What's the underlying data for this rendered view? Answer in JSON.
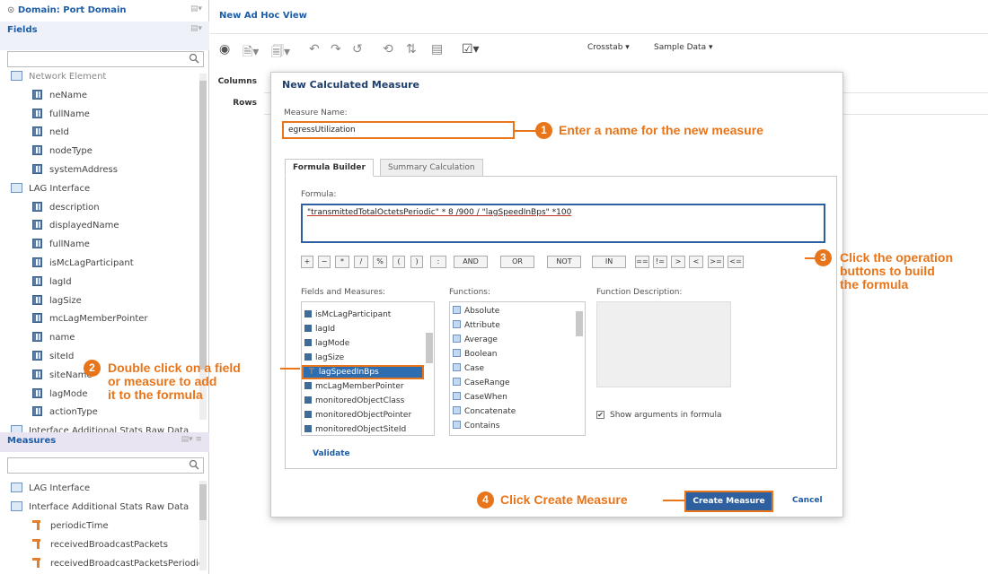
{
  "domain_panel": {
    "domain_label": "Domain: Port Domain",
    "fields_header": "Fields",
    "fields_items": [
      {
        "label": "Network Element",
        "kind": "group"
      },
      {
        "label": "neName",
        "kind": "field"
      },
      {
        "label": "fullName",
        "kind": "field"
      },
      {
        "label": "neId",
        "kind": "field"
      },
      {
        "label": "nodeType",
        "kind": "field"
      },
      {
        "label": "systemAddress",
        "kind": "field"
      },
      {
        "label": "LAG Interface",
        "kind": "group"
      },
      {
        "label": "description",
        "kind": "field"
      },
      {
        "label": "displayedName",
        "kind": "field"
      },
      {
        "label": "fullName",
        "kind": "field"
      },
      {
        "label": "isMcLagParticipant",
        "kind": "field"
      },
      {
        "label": "lagId",
        "kind": "field"
      },
      {
        "label": "lagSize",
        "kind": "field"
      },
      {
        "label": "mcLagMemberPointer",
        "kind": "field"
      },
      {
        "label": "name",
        "kind": "field"
      },
      {
        "label": "siteId",
        "kind": "field"
      },
      {
        "label": "siteName",
        "kind": "field"
      },
      {
        "label": "lagMode",
        "kind": "field"
      },
      {
        "label": "actionType",
        "kind": "field"
      },
      {
        "label": "Interface Additional Stats Raw Data",
        "kind": "group"
      }
    ],
    "measures_header": "Measures",
    "measures_items": [
      {
        "label": "LAG Interface",
        "kind": "group"
      },
      {
        "label": "Interface Additional Stats Raw Data",
        "kind": "group"
      },
      {
        "label": "periodicTime",
        "kind": "measure"
      },
      {
        "label": "receivedBroadcastPackets",
        "kind": "measure"
      },
      {
        "label": "receivedBroadcastPacketsPeriodic",
        "kind": "measure"
      }
    ]
  },
  "header": {
    "title": "New Ad Hoc View"
  },
  "toolbar": {
    "crosstab": "Crosstab ▾",
    "sample_data": "Sample Data ▾"
  },
  "layout": {
    "columns": "Columns",
    "rows": "Rows"
  },
  "dialog": {
    "title": "New Calculated Measure",
    "measure_name_label": "Measure Name:",
    "measure_name_value": "egressUtilization",
    "tabs": [
      "Formula Builder",
      "Summary Calculation"
    ],
    "formula_label": "Formula:",
    "formula_value": "\"transmittedTotalOctetsPeriodic\" * 8 /900 / \"lagSpeedInBps\" *100",
    "operators": [
      "+",
      "−",
      "*",
      "/",
      "%",
      "(",
      ")",
      ":",
      "AND",
      "OR",
      "NOT",
      "IN",
      "==",
      "!=",
      ">",
      "<",
      ">=",
      "<="
    ],
    "fields_label": "Fields and Measures:",
    "fields_list": [
      "isMcLagParticipant",
      "lagId",
      "lagMode",
      "lagSize",
      "lagSpeedInBps",
      "mcLagMemberPointer",
      "monitoredObjectClass",
      "monitoredObjectPointer",
      "monitoredObjectSiteId"
    ],
    "fields_selected": "lagSpeedInBps",
    "functions_label": "Functions:",
    "functions_list": [
      "Absolute",
      "Attribute",
      "Average",
      "Boolean",
      "Case",
      "CaseRange",
      "CaseWhen",
      "Concatenate",
      "Contains"
    ],
    "function_desc_label": "Function Description:",
    "show_args_label": "Show arguments in formula",
    "validate": "Validate",
    "create": "Create Measure",
    "cancel": "Cancel"
  },
  "annotations": {
    "step1_num": "1",
    "step1_text": "Enter a name for the new measure",
    "step2_num": "2",
    "step2_line1": "Double click on a field",
    "step2_line2": "or measure to add",
    "step2_line3": "it to the formula",
    "step3_num": "3",
    "step3_line1": "Click the operation",
    "step3_line2": "buttons to build",
    "step3_line3": "the formula",
    "step4_num": "4",
    "step4_text": "Click Create Measure"
  },
  "colors": {
    "accent": "#e8751a",
    "brand": "#1d5da8",
    "primary_button": "#2e5f9e"
  }
}
